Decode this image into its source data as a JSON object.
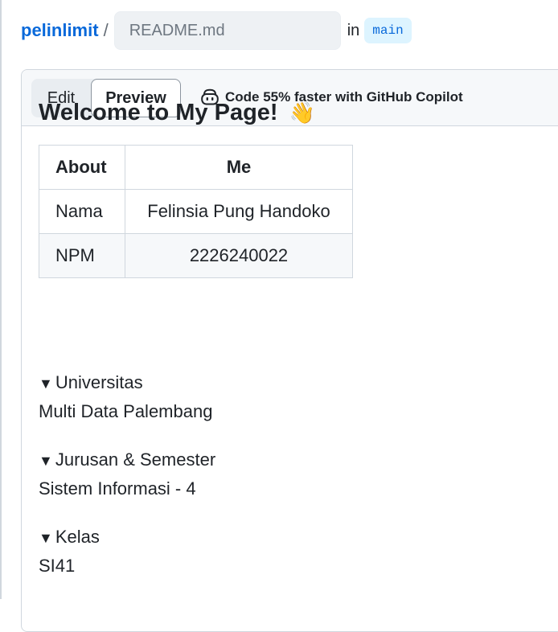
{
  "breadcrumb": {
    "repo": "pelinlimit",
    "separator": "/",
    "filename_placeholder": "README.md",
    "in_label": "in",
    "branch": "main"
  },
  "editor": {
    "tabs": {
      "edit": "Edit",
      "preview": "Preview"
    },
    "copilot_text": "Code 55% faster with GitHub Copilot"
  },
  "preview": {
    "title": "Welcome to My Page!",
    "title_emoji": "👋",
    "table": {
      "headers": [
        "About",
        "Me"
      ],
      "rows": [
        [
          "Nama",
          "Felinsia Pung Handoko"
        ],
        [
          "NPM",
          "2226240022"
        ]
      ]
    },
    "details": [
      {
        "summary": "Universitas",
        "body": "Multi Data Palembang"
      },
      {
        "summary": "Jurusan & Semester",
        "body": "Sistem Informasi - 4"
      },
      {
        "summary": "Kelas",
        "body": "SI41"
      }
    ],
    "toggle_glyph": "▼"
  }
}
